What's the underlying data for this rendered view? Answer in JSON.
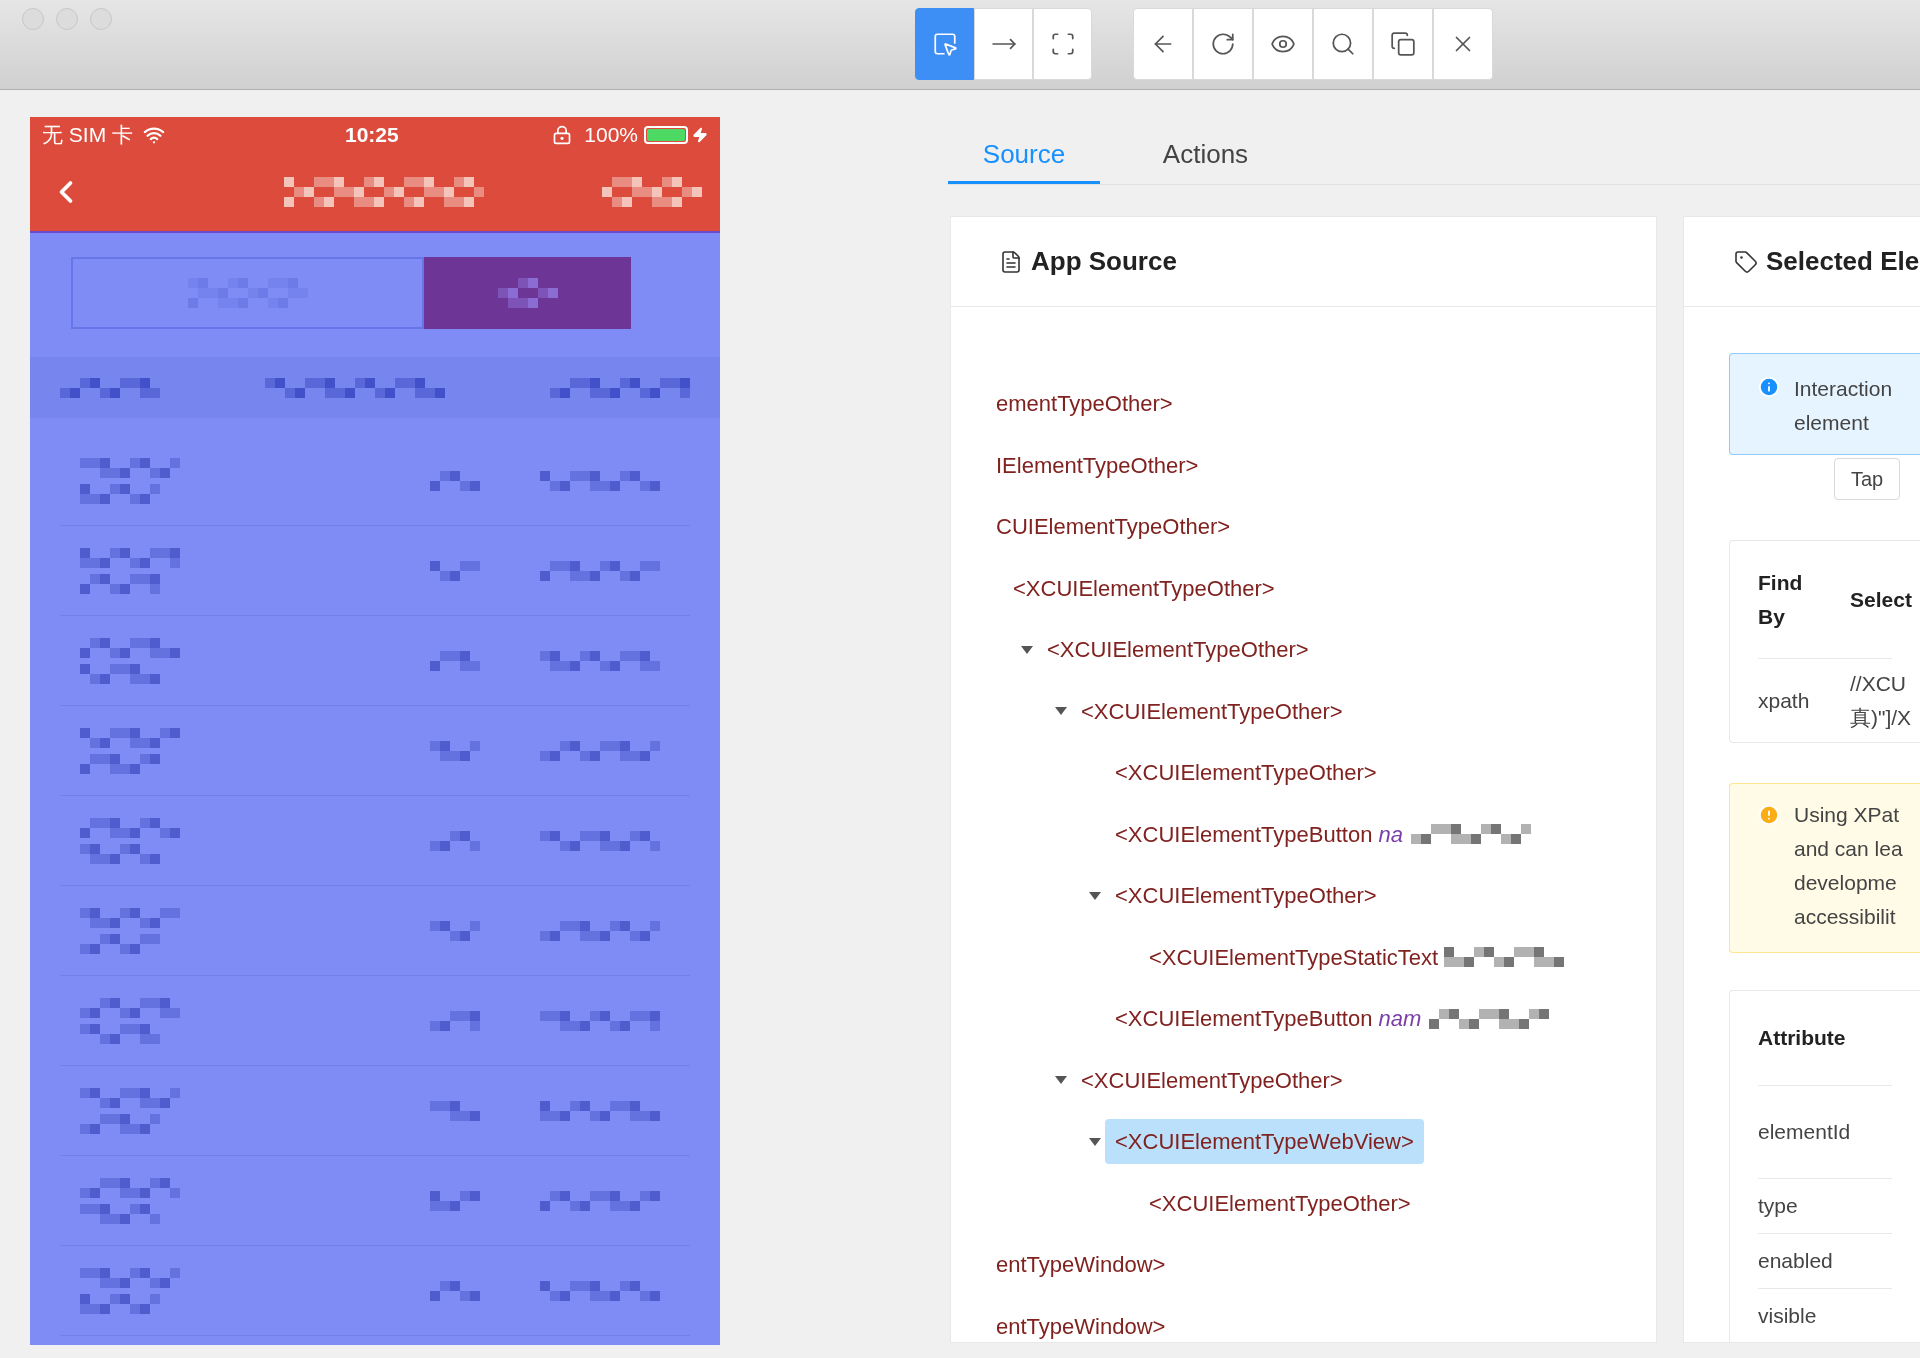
{
  "toolbar": {
    "modes": [
      {
        "selected": true
      },
      {
        "selected": false
      },
      {
        "selected": false
      }
    ]
  },
  "phone": {
    "carrier": "无 SIM 卡",
    "time": "10:25",
    "battery": "100%",
    "segments": [
      {
        "selected": false
      },
      {
        "selected": true
      }
    ]
  },
  "tabs": [
    {
      "label": "Source",
      "selected": true
    },
    {
      "label": "Actions",
      "selected": false
    }
  ],
  "app_source": {
    "title": "App Source",
    "tree": [
      {
        "tag": "ementTypeOther>",
        "selected": false
      },
      {
        "tag": "IElementTypeOther>",
        "selected": false
      },
      {
        "tag": "CUIElementTypeOther>",
        "selected": false,
        "children": [
          {
            "tag": "<XCUIElementTypeOther>",
            "selected": false,
            "children": [
              {
                "tag": "<XCUIElementTypeOther>",
                "expanded": true,
                "selected": false,
                "children": [
                  {
                    "tag": "<XCUIElementTypeOther>",
                    "expanded": true,
                    "selected": false,
                    "children": [
                      {
                        "tag": "<XCUIElementTypeOther>",
                        "selected": false
                      },
                      {
                        "tag": "<XCUIElementTypeButton",
                        "attr": "na",
                        "redacted": true,
                        "selected": false
                      },
                      {
                        "tag": "<XCUIElementTypeOther>",
                        "expanded": true,
                        "selected": false,
                        "children": [
                          {
                            "tag": "<XCUIElementTypeStaticText",
                            "redacted": true,
                            "selected": false
                          }
                        ]
                      },
                      {
                        "tag": "<XCUIElementTypeButton",
                        "attr": "nam",
                        "redacted": true,
                        "selected": false
                      }
                    ]
                  },
                  {
                    "tag": "<XCUIElementTypeOther>",
                    "expanded": true,
                    "selected": false,
                    "children": [
                      {
                        "tag": "<XCUIElementTypeWebView>",
                        "expanded": true,
                        "selected": true,
                        "children": [
                          {
                            "tag": "<XCUIElementTypeOther>",
                            "selected": false
                          }
                        ]
                      }
                    ]
                  }
                ]
              }
            ]
          }
        ]
      },
      {
        "tag": "entTypeWindow>",
        "selected": false
      },
      {
        "tag": "entTypeWindow>",
        "selected": false
      }
    ]
  },
  "selected_element": {
    "title": "Selected Ele",
    "info": [
      "Interaction",
      "element"
    ],
    "tap_button": "Tap",
    "find_table": {
      "columns": [
        "Find By",
        "Select"
      ],
      "rows": [
        [
          "xpath",
          "//XCU 真)\"]/X"
        ]
      ]
    },
    "warning": [
      "Using XPat",
      "and can lea",
      "developme",
      "accessibilit"
    ],
    "attributes": {
      "column": "Attribute",
      "rows": [
        "elementId",
        "type",
        "enabled",
        "visible"
      ]
    }
  }
}
